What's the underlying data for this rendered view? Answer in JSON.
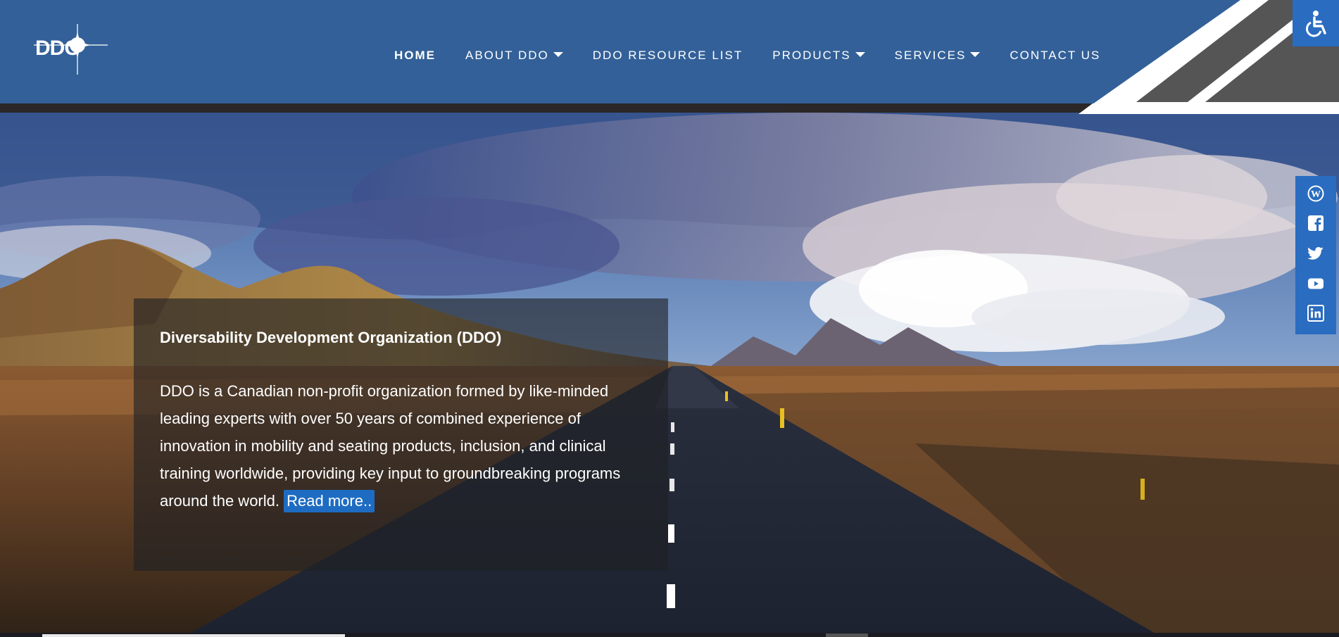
{
  "logo": {
    "text": "DDO"
  },
  "nav": {
    "items": [
      {
        "label": "HOME",
        "active": true,
        "has_dropdown": false
      },
      {
        "label": "ABOUT DDO",
        "active": false,
        "has_dropdown": true
      },
      {
        "label": "DDO RESOURCE LIST",
        "active": false,
        "has_dropdown": false
      },
      {
        "label": "PRODUCTS",
        "active": false,
        "has_dropdown": true
      },
      {
        "label": "SERVICES",
        "active": false,
        "has_dropdown": true
      },
      {
        "label": "CONTACT US",
        "active": false,
        "has_dropdown": false
      }
    ]
  },
  "accessibility": {
    "icon": "wheelchair-icon"
  },
  "hero": {
    "title": "Diversability Development Organization (DDO)",
    "body": "DDO is a Canadian non-profit organization formed by like-minded leading experts with over 50 years of combined experience of innovation in mobility and seating products, inclusion, and clinical training worldwide, providing key input to groundbreaking programs around the world.",
    "read_more": "Read more.."
  },
  "social": {
    "icons": [
      "wordpress-icon",
      "facebook-icon",
      "twitter-icon",
      "youtube-icon",
      "linkedin-icon"
    ]
  },
  "colors": {
    "header_blue": "#336098",
    "accent_blue": "#2a6cc0",
    "dark_strip": "#2b2627",
    "diagonal_grey": "#555555"
  }
}
